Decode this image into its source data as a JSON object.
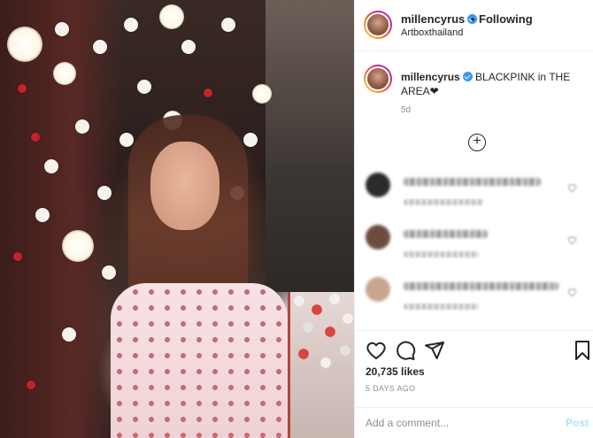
{
  "post_image": {
    "alt": ""
  },
  "header": {
    "username": "millencyrus",
    "separator": "•",
    "follow_label": "Following",
    "location": "Artboxthailand"
  },
  "caption": {
    "username": "millencyrus",
    "text": "BLACKPINK in THE AREA❤",
    "age": "5d"
  },
  "load_more_symbol": "+",
  "comments": [
    {
      "avatar_color": "#2b2b2b",
      "blurred": true
    },
    {
      "avatar_color": "#6d4b3f",
      "blurred": true
    },
    {
      "avatar_color": "#c9a48f",
      "blurred": true
    }
  ],
  "actions": {
    "likes": "20,735 likes",
    "timestamp": "5 DAYS AGO"
  },
  "add_comment": {
    "placeholder": "Add a comment...",
    "post_label": "Post"
  },
  "colors": {
    "verified": "#3897f0",
    "post_button_disabled": "#b2dffc",
    "secondary_text": "#8e8e8e"
  }
}
